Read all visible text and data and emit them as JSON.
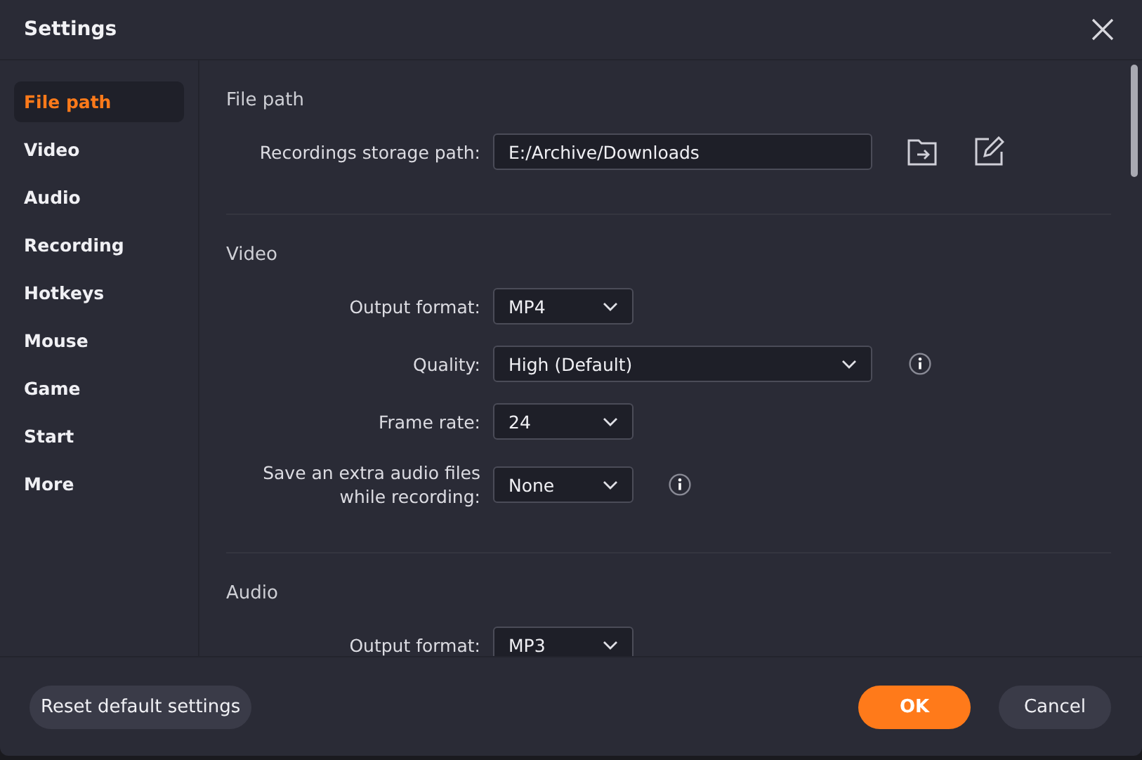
{
  "window": {
    "title": "Settings"
  },
  "sidebar": {
    "items": [
      {
        "label": "File path",
        "selected": true
      },
      {
        "label": "Video",
        "selected": false
      },
      {
        "label": "Audio",
        "selected": false
      },
      {
        "label": "Recording",
        "selected": false
      },
      {
        "label": "Hotkeys",
        "selected": false
      },
      {
        "label": "Mouse",
        "selected": false
      },
      {
        "label": "Game",
        "selected": false
      },
      {
        "label": "Start",
        "selected": false
      },
      {
        "label": "More",
        "selected": false
      }
    ]
  },
  "sections": [
    {
      "title": "File path",
      "rows": [
        {
          "kind": "path",
          "label": "Recordings storage path:",
          "value": "E:/Archive/Downloads",
          "info": false
        }
      ]
    },
    {
      "title": "Video",
      "rows": [
        {
          "kind": "select",
          "label": "Output format:",
          "value": "MP4",
          "info": false
        },
        {
          "kind": "select-wide",
          "label": "Quality:",
          "value": "High (Default)",
          "info": true
        },
        {
          "kind": "select",
          "label": "Frame rate:",
          "value": "24",
          "info": false
        },
        {
          "kind": "select",
          "label": "Save an extra audio files while recording:",
          "value": "None",
          "info": true
        }
      ]
    },
    {
      "title": "Audio",
      "rows": [
        {
          "kind": "select",
          "label": "Output format:",
          "value": "MP3",
          "info": false
        }
      ]
    }
  ],
  "footer": {
    "reset": "Reset default settings",
    "ok": "OK",
    "cancel": "Cancel"
  }
}
